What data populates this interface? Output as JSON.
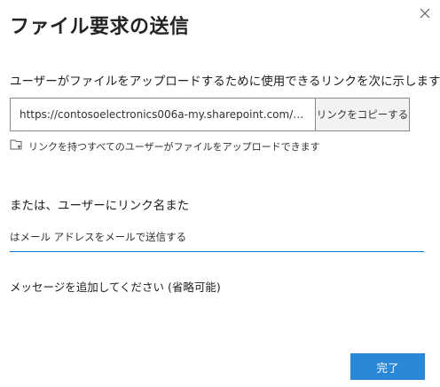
{
  "dialog": {
    "title": "ファイル要求の送信",
    "close_icon": "close-icon"
  },
  "link_section": {
    "description": "ユーザーがファイルをアップロードするために使用できるリンクを次に示します",
    "link_value": "https://contosoelectronics006a-my.sharepoint.com/:f...",
    "copy_button_label": "リンクをコピーする"
  },
  "permission": {
    "icon": "folder-upload-icon",
    "text": "リンクを持つすべてのユーザーがファイルをアップロードできます"
  },
  "email_section": {
    "label": "または、ユーザーにリンク名また",
    "placeholder": "はメール アドレスをメールで送信する"
  },
  "message_section": {
    "label": "メッセージを追加してください (省略可能)"
  },
  "footer": {
    "done_label": "完了"
  },
  "colors": {
    "primary": "#2b88d8",
    "underline": "#0078d4",
    "button_bg": "#f3f2f1",
    "border": "#8a8886"
  }
}
